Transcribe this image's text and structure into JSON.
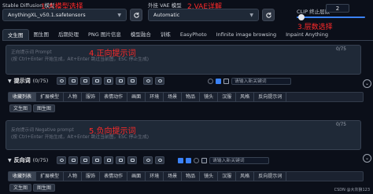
{
  "colors": {
    "accent": "#3b82f6",
    "annotation": "#ff2a2a",
    "bg": "#0b0f19",
    "panel": "#1f2937"
  },
  "top": {
    "model_label": "Stable Diffusion 模型",
    "model_value": "AnythingXL_v50.1.safetensors",
    "vae_label": "外挂 VAE 模型",
    "vae_value": "Automatic",
    "clip_label": "CLIP 终止层数",
    "clip_value": "2"
  },
  "annotations": {
    "model": "1.大模型选择",
    "vae": "2.VAE详解",
    "clip": "3.层数选择",
    "positive": "4.正向提示词",
    "negative": "5.负向提示词"
  },
  "tabs": [
    "文生图",
    "图生图",
    "后期处理",
    "PNG 图片信息",
    "模型融合",
    "训练",
    "EasyPhoto",
    "Infinite image browsing",
    "Inpaint Anything"
  ],
  "positive": {
    "placeholder_1": "正向提示词 Prompt",
    "placeholder_2": "(按 Ctrl+Enter 开始生成，Alt+Enter 跳过当前图，ESC 停止生成)",
    "counter": "0/75",
    "toolbar_label": "提示词",
    "toolbar_count": "(0/75)",
    "new_keyword_placeholder": "请输入新关键词"
  },
  "categories": [
    "收藏列表",
    "扩展模型",
    "人物",
    "服饰",
    "表情动作",
    "画面",
    "环境",
    "场景",
    "物品",
    "镜头",
    "汉服",
    "风格",
    "反向提示词"
  ],
  "sub_buttons": [
    "文生图",
    "图生图"
  ],
  "negative": {
    "placeholder_1": "反向提示词 Negative prompt",
    "placeholder_2": "(按 Ctrl+Enter 开始生成，Alt+Enter 跳过当前图，ESC 停止生成)",
    "counter": "0/75",
    "toolbar_label": "反向词",
    "toolbar_count": "(0/75)",
    "new_keyword_placeholder": "请输入新关键词"
  },
  "categories_2": [
    "收藏列表",
    "扩展模型",
    "人物",
    "服饰",
    "表情动作",
    "画面",
    "环境",
    "场景",
    "物品",
    "镜头",
    "汉服",
    "风格",
    "反向提示词"
  ],
  "sub_buttons_2": [
    "文生图",
    "图生图"
  ],
  "watermark": "CSDN @大灰狼123"
}
